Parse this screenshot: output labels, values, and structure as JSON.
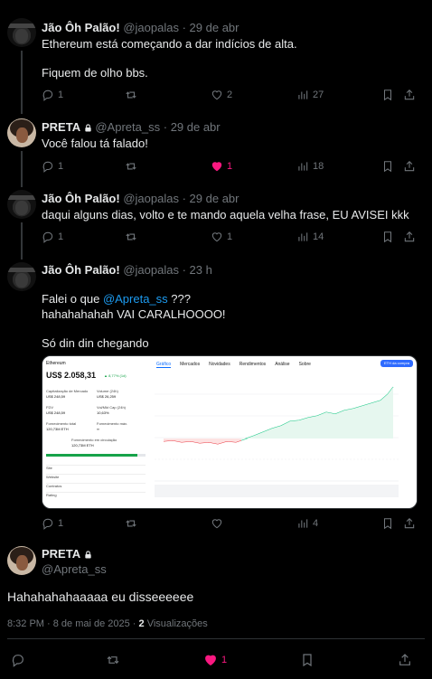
{
  "tweets": [
    {
      "name": "Jão Ôh Palão!",
      "handle": "@jaopalas",
      "time": "29 de abr",
      "text": "Ethereum está começando a dar indícios de alta.\n\nFiquem de olho bbs.",
      "replies": "1",
      "retweets": "",
      "likes": "2",
      "views": "27"
    },
    {
      "name": "PRETA",
      "handle": "@Apreta_ss",
      "time": "29 de abr",
      "text": "Você falou tá falado!",
      "replies": "1",
      "retweets": "",
      "likes": "1",
      "views": "18"
    },
    {
      "name": "Jão Ôh Palão!",
      "handle": "@jaopalas",
      "time": "29 de abr",
      "text": "daqui alguns dias, volto e te mando aquela velha frase, EU AVISEI kkk",
      "replies": "1",
      "retweets": "",
      "likes": "1",
      "views": "14"
    },
    {
      "name": "Jão Ôh Palão!",
      "handle": "@jaopalas",
      "time": "23 h",
      "text_prefix": "Falei o que ",
      "mention": "@Apreta_ss",
      "text_suffix": " ???",
      "text2": "hahahahahah VAI CARALHOOOO!\n\nSó din din chegando",
      "replies": "1",
      "retweets": "",
      "likes": "",
      "views": "4"
    }
  ],
  "embed": {
    "coin": "Ethereum",
    "price": "US$ 2.058,31",
    "change": "▲ 8,77% (1d)",
    "tabs": [
      "Gráfico",
      "Mercados",
      "Novidades",
      "Rendimentos",
      "Análise",
      "Sobre"
    ],
    "cta": "ETH da compra",
    "stats": [
      "Capitalização de Mercado",
      "US$ 248,59",
      "Volume (24h)",
      "US$ 26,259",
      "FDV",
      "US$ 248,59",
      "Vol/Mkt Cap (24h)",
      "10,63%",
      "Fornecimento total",
      "120,73M ETH",
      "Fornecimento máx.",
      "∞",
      "Fornecimento em circulação",
      "120,73M ETH"
    ],
    "rows": [
      "Site",
      "Website",
      "Contratos",
      "Rating"
    ]
  },
  "main": {
    "name": "PRETA",
    "handle": "@Apreta_ss",
    "text": "Hahahahahaaaaa eu disseeeeee",
    "time": "8:32 PM · 8 de mai de 2025 ·",
    "views_count": "2",
    "views_label": "Visualizações",
    "likes": "1"
  },
  "colors": {
    "like": "#f91880",
    "link": "#1d9bf0",
    "muted": "#71767b"
  }
}
